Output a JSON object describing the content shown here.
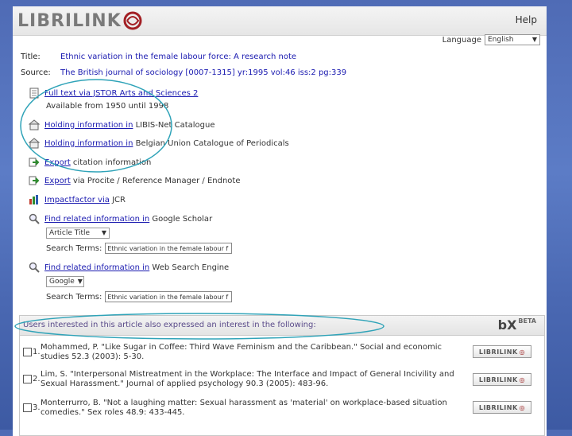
{
  "header": {
    "logo_text": "LIBRILINK",
    "help_label": "Help"
  },
  "language": {
    "label": "Language",
    "selected": "English"
  },
  "record": {
    "title_label": "Title:",
    "title_value": "Ethnic variation in the female labour force: A research note",
    "source_label": "Source:",
    "source_value": "The British journal of sociology [0007-1315] yr:1995 vol:46 iss:2 pg:339"
  },
  "services": [
    {
      "link": "Full text via JSTOR Arts and Sciences 2",
      "rest": "",
      "sub": "Available from 1950 until 1998"
    },
    {
      "link": "Holding information in",
      "rest": " LIBIS-Net Catalogue"
    },
    {
      "link": "Holding information in",
      "rest": " Belgian Union Catalogue of Periodicals"
    },
    {
      "link": "Export",
      "rest": " citation information"
    },
    {
      "link": "Export",
      "rest": " via Procite / Reference Manager / Endnote"
    },
    {
      "link": "Impactfactor via",
      "rest": " JCR"
    },
    {
      "link": "Find related information in",
      "rest": " Google Scholar"
    },
    {
      "link": "Find related information in",
      "rest": " Web Search Engine"
    }
  ],
  "scholar_search": {
    "type_selected": "Article Title",
    "terms_label": "Search Terms:",
    "terms_value": "Ethnic variation in the female labour f"
  },
  "web_search": {
    "engine_selected": "Google",
    "terms_label": "Search Terms:",
    "terms_value": "Ethnic variation in the female labour f"
  },
  "recommendations": {
    "title": "Users interested in this article also expressed an interest in the following:",
    "brand": "bX",
    "brand_tag": "BETA",
    "items": [
      {
        "num": "1.",
        "text": "Mohammed, P. \"Like Sugar in Coffee: Third Wave Feminism and the Caribbean.\" Social and economic studies 52.3 (2003): 5-30.",
        "button": "LIBRILINK"
      },
      {
        "num": "2.",
        "text": "Lim, S. \"Interpersonal Mistreatment in the Workplace: The Interface and Impact of General Incivility and Sexual Harassment.\" Journal of applied psychology 90.3 (2005): 483-96.",
        "button": "LIBRILINK"
      },
      {
        "num": "3.",
        "text": "Monterrurro, B. \"Not a laughing matter: Sexual harassment as 'material' on workplace-based situation comedies.\" Sex roles 48.9: 433-445.",
        "button": "LIBRILINK"
      }
    ]
  },
  "colors": {
    "link": "#1a1ab0",
    "annotation": "#2fa3b8",
    "brand_accent": "#9a1a1a"
  }
}
